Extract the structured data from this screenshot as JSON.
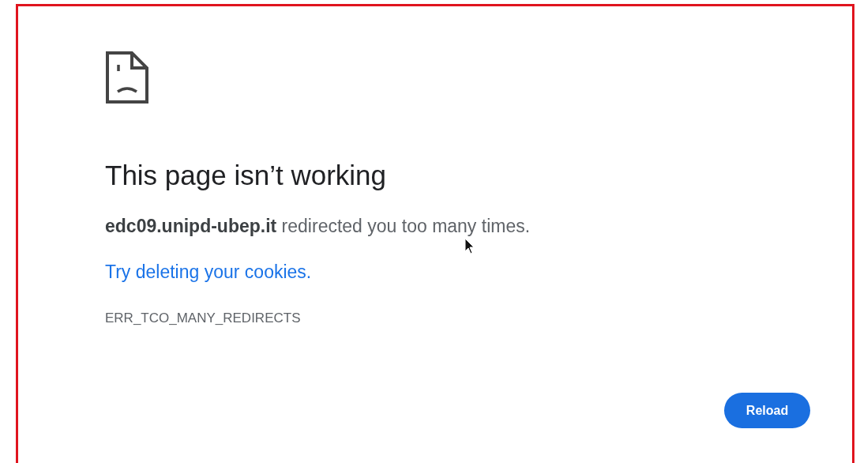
{
  "error_page": {
    "heading": "This page isn’t working",
    "message": "**edc09.unipd-ubep.it** redirected you too many times.",
    "suggestion_link": "Try deleting your cookies.",
    "error_code": "ERR_TCO_MANY_REDIRECTS",
    "button": "Reload"
  }
}
